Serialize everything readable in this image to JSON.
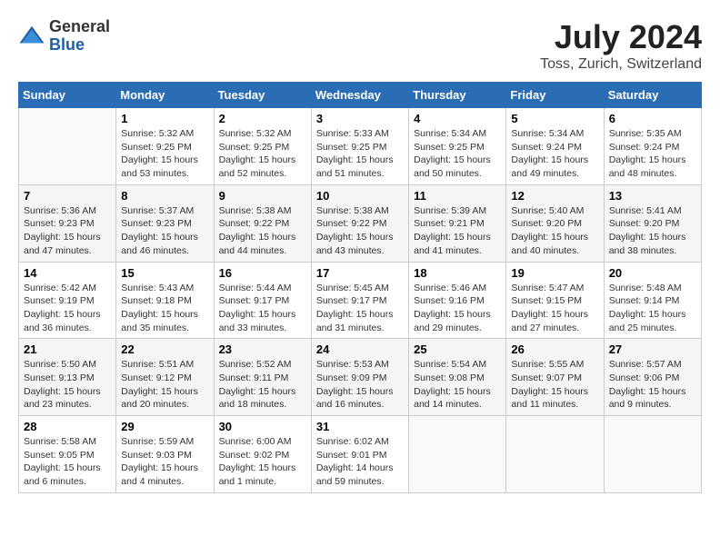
{
  "header": {
    "logo_general": "General",
    "logo_blue": "Blue",
    "month_year": "July 2024",
    "location": "Toss, Zurich, Switzerland"
  },
  "weekdays": [
    "Sunday",
    "Monday",
    "Tuesday",
    "Wednesday",
    "Thursday",
    "Friday",
    "Saturday"
  ],
  "weeks": [
    [
      {
        "day": "",
        "info": ""
      },
      {
        "day": "1",
        "info": "Sunrise: 5:32 AM\nSunset: 9:25 PM\nDaylight: 15 hours\nand 53 minutes."
      },
      {
        "day": "2",
        "info": "Sunrise: 5:32 AM\nSunset: 9:25 PM\nDaylight: 15 hours\nand 52 minutes."
      },
      {
        "day": "3",
        "info": "Sunrise: 5:33 AM\nSunset: 9:25 PM\nDaylight: 15 hours\nand 51 minutes."
      },
      {
        "day": "4",
        "info": "Sunrise: 5:34 AM\nSunset: 9:25 PM\nDaylight: 15 hours\nand 50 minutes."
      },
      {
        "day": "5",
        "info": "Sunrise: 5:34 AM\nSunset: 9:24 PM\nDaylight: 15 hours\nand 49 minutes."
      },
      {
        "day": "6",
        "info": "Sunrise: 5:35 AM\nSunset: 9:24 PM\nDaylight: 15 hours\nand 48 minutes."
      }
    ],
    [
      {
        "day": "7",
        "info": "Sunrise: 5:36 AM\nSunset: 9:23 PM\nDaylight: 15 hours\nand 47 minutes."
      },
      {
        "day": "8",
        "info": "Sunrise: 5:37 AM\nSunset: 9:23 PM\nDaylight: 15 hours\nand 46 minutes."
      },
      {
        "day": "9",
        "info": "Sunrise: 5:38 AM\nSunset: 9:22 PM\nDaylight: 15 hours\nand 44 minutes."
      },
      {
        "day": "10",
        "info": "Sunrise: 5:38 AM\nSunset: 9:22 PM\nDaylight: 15 hours\nand 43 minutes."
      },
      {
        "day": "11",
        "info": "Sunrise: 5:39 AM\nSunset: 9:21 PM\nDaylight: 15 hours\nand 41 minutes."
      },
      {
        "day": "12",
        "info": "Sunrise: 5:40 AM\nSunset: 9:20 PM\nDaylight: 15 hours\nand 40 minutes."
      },
      {
        "day": "13",
        "info": "Sunrise: 5:41 AM\nSunset: 9:20 PM\nDaylight: 15 hours\nand 38 minutes."
      }
    ],
    [
      {
        "day": "14",
        "info": "Sunrise: 5:42 AM\nSunset: 9:19 PM\nDaylight: 15 hours\nand 36 minutes."
      },
      {
        "day": "15",
        "info": "Sunrise: 5:43 AM\nSunset: 9:18 PM\nDaylight: 15 hours\nand 35 minutes."
      },
      {
        "day": "16",
        "info": "Sunrise: 5:44 AM\nSunset: 9:17 PM\nDaylight: 15 hours\nand 33 minutes."
      },
      {
        "day": "17",
        "info": "Sunrise: 5:45 AM\nSunset: 9:17 PM\nDaylight: 15 hours\nand 31 minutes."
      },
      {
        "day": "18",
        "info": "Sunrise: 5:46 AM\nSunset: 9:16 PM\nDaylight: 15 hours\nand 29 minutes."
      },
      {
        "day": "19",
        "info": "Sunrise: 5:47 AM\nSunset: 9:15 PM\nDaylight: 15 hours\nand 27 minutes."
      },
      {
        "day": "20",
        "info": "Sunrise: 5:48 AM\nSunset: 9:14 PM\nDaylight: 15 hours\nand 25 minutes."
      }
    ],
    [
      {
        "day": "21",
        "info": "Sunrise: 5:50 AM\nSunset: 9:13 PM\nDaylight: 15 hours\nand 23 minutes."
      },
      {
        "day": "22",
        "info": "Sunrise: 5:51 AM\nSunset: 9:12 PM\nDaylight: 15 hours\nand 20 minutes."
      },
      {
        "day": "23",
        "info": "Sunrise: 5:52 AM\nSunset: 9:11 PM\nDaylight: 15 hours\nand 18 minutes."
      },
      {
        "day": "24",
        "info": "Sunrise: 5:53 AM\nSunset: 9:09 PM\nDaylight: 15 hours\nand 16 minutes."
      },
      {
        "day": "25",
        "info": "Sunrise: 5:54 AM\nSunset: 9:08 PM\nDaylight: 15 hours\nand 14 minutes."
      },
      {
        "day": "26",
        "info": "Sunrise: 5:55 AM\nSunset: 9:07 PM\nDaylight: 15 hours\nand 11 minutes."
      },
      {
        "day": "27",
        "info": "Sunrise: 5:57 AM\nSunset: 9:06 PM\nDaylight: 15 hours\nand 9 minutes."
      }
    ],
    [
      {
        "day": "28",
        "info": "Sunrise: 5:58 AM\nSunset: 9:05 PM\nDaylight: 15 hours\nand 6 minutes."
      },
      {
        "day": "29",
        "info": "Sunrise: 5:59 AM\nSunset: 9:03 PM\nDaylight: 15 hours\nand 4 minutes."
      },
      {
        "day": "30",
        "info": "Sunrise: 6:00 AM\nSunset: 9:02 PM\nDaylight: 15 hours\nand 1 minute."
      },
      {
        "day": "31",
        "info": "Sunrise: 6:02 AM\nSunset: 9:01 PM\nDaylight: 14 hours\nand 59 minutes."
      },
      {
        "day": "",
        "info": ""
      },
      {
        "day": "",
        "info": ""
      },
      {
        "day": "",
        "info": ""
      }
    ]
  ]
}
